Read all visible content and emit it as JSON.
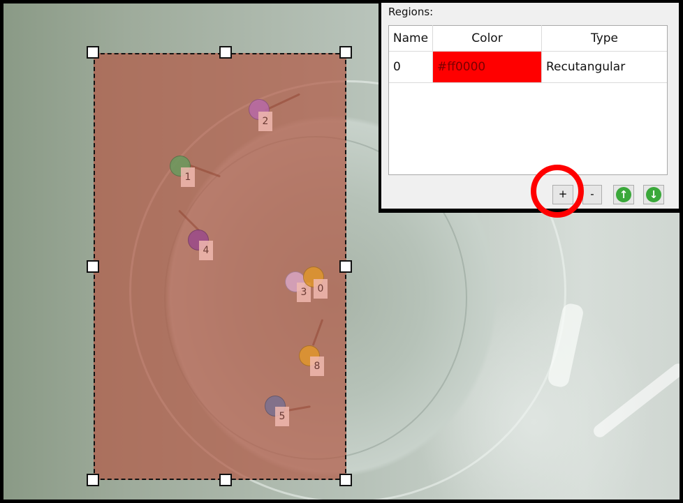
{
  "panel": {
    "title": "Regions:",
    "columns": [
      "Name",
      "Color",
      "Type"
    ],
    "rows": [
      {
        "name": "0",
        "color": "#ff0000",
        "color_label": "#ff0000",
        "type": "Recutangular"
      }
    ],
    "buttons": {
      "add": "+",
      "remove": "-",
      "up": "↑",
      "down": "↓"
    }
  },
  "markers": [
    {
      "id": "2",
      "color": "#b86aa8"
    },
    {
      "id": "1",
      "color": "#6a9a5e"
    },
    {
      "id": "4",
      "color": "#9a4a8a"
    },
    {
      "id": "3",
      "color": "#d8a6c4"
    },
    {
      "id": "0",
      "color": "#e0962c"
    },
    {
      "id": "8",
      "color": "#e0962c"
    },
    {
      "id": "5",
      "color": "#7a7090"
    }
  ],
  "colors": {
    "region_fill": "#b25c48",
    "highlight": "#ff0000",
    "arrow_button": "#3aa83a"
  }
}
